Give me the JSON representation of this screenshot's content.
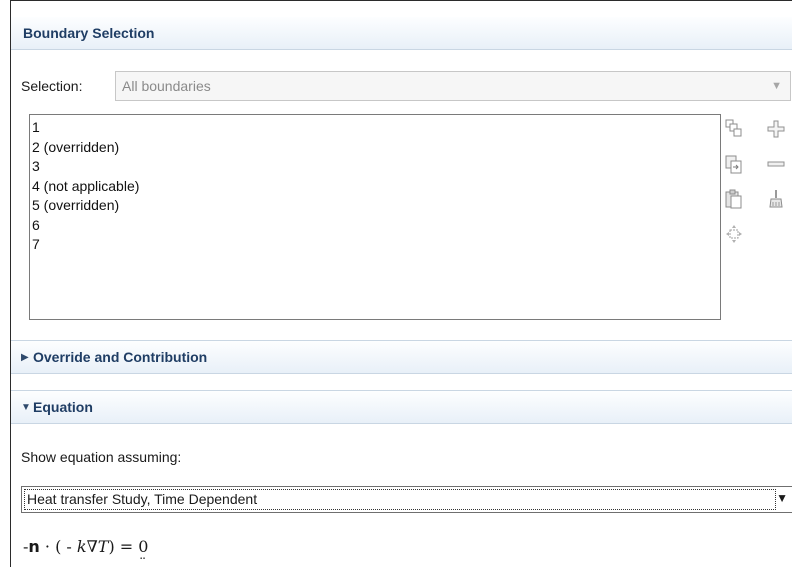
{
  "boundary_selection": {
    "title": "Boundary Selection",
    "selection_label": "Selection:",
    "selection_value": "All boundaries",
    "boundaries": [
      "1",
      "2 (overridden)",
      "3",
      "4 (not applicable)",
      "5 (overridden)",
      "6",
      "7"
    ]
  },
  "override_section": {
    "title": "Override and Contribution",
    "expanded": false
  },
  "equation_section": {
    "title": "Equation",
    "expanded": true,
    "show_label": "Show equation assuming:",
    "study_value": "Heat transfer Study, Time Dependent",
    "formula": {
      "minus": "-",
      "normal": "n",
      "dot": " · ",
      "paren_open": "( - ",
      "k": "k",
      "nabla": "∇",
      "T": "T",
      "paren_close": ")",
      "equals": " = ",
      "zero": "0"
    }
  },
  "icons": [
    "copy-icon",
    "add-icon",
    "paste-selection-icon",
    "remove-icon",
    "clipboard-icon",
    "clear-selection-icon",
    "zoom-to-selection-icon"
  ]
}
